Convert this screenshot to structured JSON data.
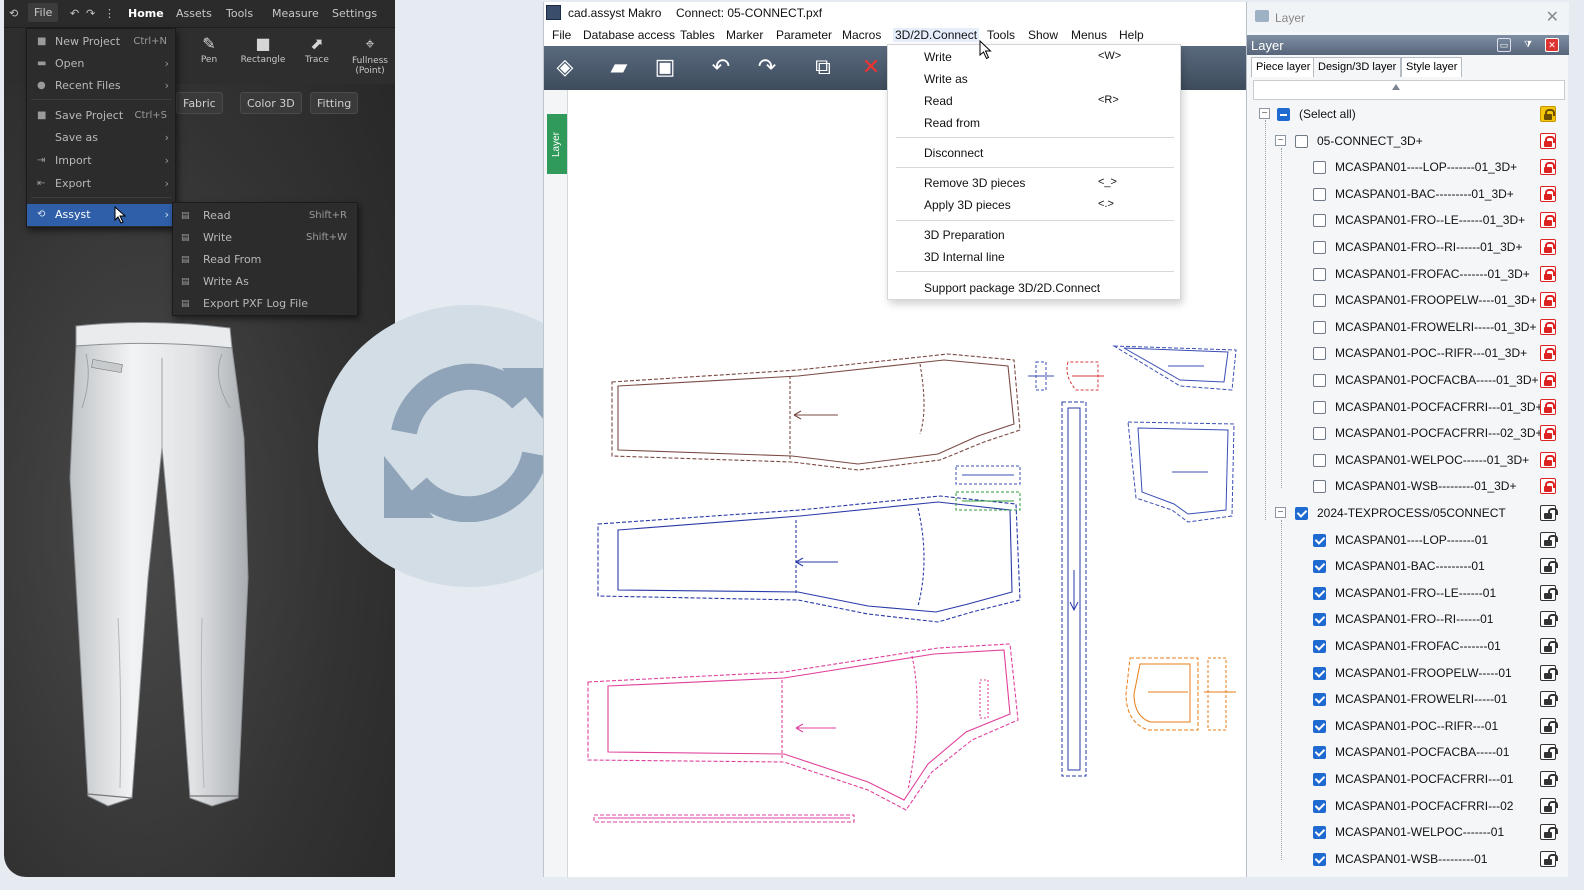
{
  "left_app": {
    "top_menu": {
      "file": "File",
      "home": "Home",
      "assets": "Assets",
      "tools": "Tools",
      "measure": "Measure",
      "settings": "Settings"
    },
    "toolbar": [
      {
        "label": "Pen",
        "icon": "pen-icon"
      },
      {
        "label": "Rectangle",
        "icon": "rectangle-icon"
      },
      {
        "label": "Trace",
        "icon": "trace-icon"
      },
      {
        "label": "Fullness (Point)",
        "icon": "fullness-icon"
      }
    ],
    "pills": [
      "Fabric",
      "Color 3D",
      "Fitting"
    ],
    "file_menu": [
      {
        "label": "New Project",
        "shortcut": "Ctrl+N"
      },
      {
        "label": "Open",
        "shortcut": ""
      },
      {
        "label": "Recent Files",
        "shortcut": ""
      },
      {
        "label": "Save Project",
        "shortcut": "Ctrl+S"
      },
      {
        "label": "Save as",
        "shortcut": ""
      },
      {
        "label": "Import",
        "shortcut": ""
      },
      {
        "label": "Export",
        "shortcut": ""
      },
      {
        "label": "Assyst",
        "shortcut": ""
      }
    ],
    "assyst_submenu": [
      {
        "label": "Read",
        "shortcut": "Shift+R"
      },
      {
        "label": "Write",
        "shortcut": "Shift+W"
      },
      {
        "label": "Read From",
        "shortcut": ""
      },
      {
        "label": "Write As",
        "shortcut": ""
      },
      {
        "label": "Export PXF Log File",
        "shortcut": ""
      }
    ]
  },
  "cad": {
    "app_name": "cad.assyst  Makro",
    "file_title": "Connect: 05-CONNECT.pxf",
    "menu": [
      "File",
      "Database access",
      "Tables",
      "Marker",
      "Parameter",
      "Macros",
      "3D/2D.Connect",
      "Tools",
      "Show",
      "Menus",
      "Help"
    ],
    "layer_tab": "Layer",
    "dropdown": {
      "write": "Write",
      "write_sc": "<W>",
      "write_as": "Write as",
      "read": "Read",
      "read_sc": "<R>",
      "read_from": "Read from",
      "disconnect": "Disconnect",
      "remove": "Remove 3D pieces",
      "remove_sc": "<_>",
      "apply": "Apply 3D pieces",
      "apply_sc": "<.>",
      "prep": "3D Preparation",
      "internal": "3D Internal line",
      "support": "Support package 3D/2D.Connect"
    }
  },
  "layer_panel": {
    "window_title": "Layer",
    "header": "Layer",
    "tabs": [
      "Piece layer",
      "Design/3D layer",
      "Style layer"
    ],
    "select_all": "(Select all)",
    "group1": {
      "name": "05-CONNECT_3D+",
      "items": [
        "MCASPAN01----LOP-------01_3D+",
        "MCASPAN01-BAC---------01_3D+",
        "MCASPAN01-FRO--LE------01_3D+",
        "MCASPAN01-FRO--RI------01_3D+",
        "MCASPAN01-FROFAC-------01_3D+",
        "MCASPAN01-FROOPELW----01_3D+",
        "MCASPAN01-FROWELRI-----01_3D+",
        "MCASPAN01-POC--RIFR---01_3D+",
        "MCASPAN01-POCFACBA-----01_3D+",
        "MCASPAN01-POCFACFRRI---01_3D+",
        "MCASPAN01-POCFACFRRI---02_3D+",
        "MCASPAN01-WELPOC------01_3D+",
        "MCASPAN01-WSB---------01_3D+"
      ]
    },
    "group2": {
      "name": "2024-TEXPROCESS/05CONNECT",
      "items": [
        "MCASPAN01----LOP-------01",
        "MCASPAN01-BAC---------01",
        "MCASPAN01-FRO--LE------01",
        "MCASPAN01-FRO--RI------01",
        "MCASPAN01-FROFAC-------01",
        "MCASPAN01-FROOPELW-----01",
        "MCASPAN01-FROWELRI-----01",
        "MCASPAN01-POC--RIFR---01",
        "MCASPAN01-POCFACBA-----01",
        "MCASPAN01-POCFACFRRI---01",
        "MCASPAN01-POCFACFRRI---02",
        "MCASPAN01-WELPOC-------01",
        "MCASPAN01-WSB---------01"
      ]
    }
  },
  "colors": {
    "accent": "#1f6ad1",
    "lock_red": "#dd2222",
    "lock_gold": "#f3c60a",
    "toolbar": "#4a5a6e",
    "sync_circle": "#d3dde6",
    "sync_arrows": "#8fa4b8"
  },
  "icons": [
    "sync-icon",
    "pointer-cursor-icon",
    "lock-icon",
    "pants-3d-icon"
  ]
}
